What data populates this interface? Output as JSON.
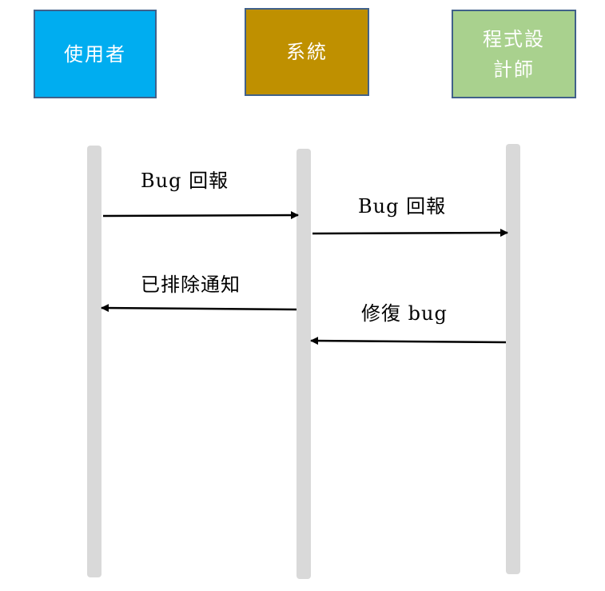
{
  "actors": {
    "user": "使用者",
    "system": "系統",
    "developer": "程式設計師"
  },
  "messages": [
    {
      "text": "Bug 回報",
      "from": "使用者",
      "to": "系統"
    },
    {
      "text": "Bug 回報",
      "from": "系統",
      "to": "程式設計師"
    },
    {
      "text": "已排除通知",
      "from": "系統",
      "to": "使用者"
    },
    {
      "text": "修復 bug",
      "from": "程式設計師",
      "to": "系統"
    }
  ],
  "colors": {
    "user_box": "#00adf0",
    "system_box": "#bf9000",
    "developer_box": "#a9d18e",
    "box_border": "#41618a",
    "lifeline": "#d9d9d9"
  }
}
